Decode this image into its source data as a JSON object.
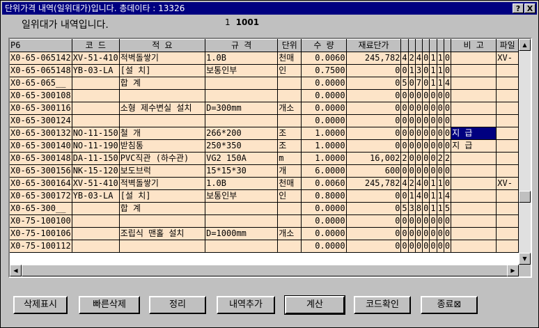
{
  "window": {
    "title": "단위가격 내역(일위대가)입니다.  총데이타 : 13326",
    "help_label": "?",
    "close_label": "X"
  },
  "header": {
    "subtitle": "일위대가 내역입니다.",
    "counter_page": "1",
    "counter_total": "1001"
  },
  "table": {
    "columns": [
      "P6",
      "코  드",
      "적     요",
      "규     격",
      "단위",
      "수   량",
      "재료단가",
      "",
      "",
      "",
      "",
      "",
      "",
      "",
      "비  고",
      "파일"
    ],
    "rows": [
      [
        "X0-65-065142",
        "XV-51-410",
        "적벽돌쌓기",
        "1.0B",
        "천매",
        "0.0060",
        "245,782",
        "4",
        "2",
        "4",
        "0",
        "1",
        "1",
        "0",
        "",
        "XV-"
      ],
      [
        "X0-65-065148",
        "YB-03-LA",
        "[설 치]",
        "보통인부",
        "인",
        "0.7500",
        "0",
        "0",
        "1",
        "3",
        "0",
        "1",
        "1",
        "0",
        "",
        ""
      ],
      [
        "X0-65-065__",
        "",
        "합    계",
        "",
        "",
        "0.0000",
        "0",
        "5",
        "0",
        "7",
        "0",
        "1",
        "1",
        "4",
        "",
        ""
      ],
      [
        "X0-65-300108",
        "",
        "",
        "",
        "",
        "0.0000",
        "0",
        "0",
        "0",
        "0",
        "0",
        "0",
        "0",
        "0",
        "",
        ""
      ],
      [
        "X0-65-300116",
        "",
        "소형 제수변실 설치",
        "D=300mm",
        "개소",
        "0.0000",
        "0",
        "0",
        "0",
        "0",
        "0",
        "0",
        "0",
        "0",
        "",
        ""
      ],
      [
        "X0-65-300124",
        "",
        "",
        "",
        "",
        "0.0000",
        "0",
        "0",
        "0",
        "0",
        "0",
        "0",
        "0",
        "0",
        "",
        ""
      ],
      [
        "X0-65-300132",
        "NO-11-150",
        "철  개",
        "266*200",
        "조",
        "1.0000",
        "0",
        "0",
        "0",
        "0",
        "0",
        "0",
        "0",
        "0",
        "지   급",
        ""
      ],
      [
        "X0-65-300140",
        "NO-11-190",
        "받침통",
        "250*350",
        "조",
        "1.0000",
        "0",
        "0",
        "0",
        "0",
        "0",
        "0",
        "0",
        "0",
        "지   급",
        ""
      ],
      [
        "X0-65-300148",
        "DA-11-150",
        "PVC직관 (하수관)",
        "VG2    150A",
        "m",
        "1.0000",
        "16,002",
        "2",
        "0",
        "0",
        "0",
        "0",
        "2",
        "2",
        "",
        ""
      ],
      [
        "X0-65-300156",
        "NK-15-120",
        "보도브럭",
        "15*15*30",
        "개",
        "6.0000",
        "600",
        "0",
        "0",
        "0",
        "0",
        "0",
        "0",
        "0",
        "",
        ""
      ],
      [
        "X0-65-300164",
        "XV-51-410",
        "적벽돌쌓기",
        "1.0B",
        "천매",
        "0.0060",
        "245,782",
        "4",
        "2",
        "4",
        "0",
        "1",
        "1",
        "0",
        "",
        "XV-"
      ],
      [
        "X0-65-300172",
        "YB-03-LA",
        "[설 치]",
        "보통인부",
        "인",
        "0.8000",
        "0",
        "0",
        "1",
        "4",
        "0",
        "1",
        "1",
        "4",
        "",
        ""
      ],
      [
        "X0-65-300__",
        "",
        "합    계",
        "",
        "",
        "0.0000",
        "0",
        "5",
        "3",
        "8",
        "0",
        "1",
        "1",
        "5",
        "",
        ""
      ],
      [
        "X0-75-100100",
        "",
        "",
        "",
        "",
        "0.0000",
        "0",
        "0",
        "0",
        "0",
        "0",
        "0",
        "0",
        "0",
        "",
        ""
      ],
      [
        "X0-75-100106",
        "",
        "조립식 맨홀 설치",
        "D=1000mm",
        "개소",
        "0.0000",
        "0",
        "0",
        "0",
        "0",
        "0",
        "0",
        "0",
        "0",
        "",
        ""
      ],
      [
        "X0-75-100112",
        "",
        "",
        "",
        "",
        "0.0000",
        "0",
        "0",
        "0",
        "0",
        "0",
        "0",
        "0",
        "0",
        "",
        ""
      ]
    ]
  },
  "buttons": {
    "delete_display": "삭제표시",
    "quick_delete": "빠른삭제",
    "arrange": "정리",
    "add_item": "내역추가",
    "calculate": "계산",
    "code_check": "코드확인",
    "exit": "종료⊠"
  },
  "scroll_icons": {
    "up": "▲",
    "down": "▼",
    "left": "◀",
    "right": "▶"
  }
}
